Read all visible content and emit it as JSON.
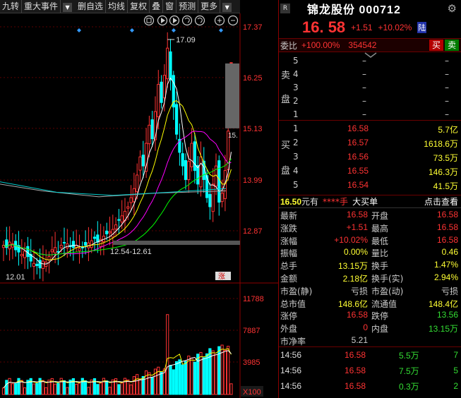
{
  "toolbar": {
    "items": [
      "九转",
      "重大事件",
      "",
      "删自选",
      "均线",
      "复权",
      "叠",
      "窗",
      "预测",
      "更多"
    ],
    "more_arrow": "▼"
  },
  "chart": {
    "price_axis": [
      "17.37",
      "16.25",
      "15.13",
      "13.99",
      "12.87"
    ],
    "vol_axis": [
      "11788",
      "7887",
      "3985"
    ],
    "vol_unit": "X100",
    "high_label": "17.09",
    "low_label": "12.01",
    "range_label": "12.54-12.61",
    "last_label": "15.",
    "tag": "涨",
    "tool_icons": [
      "hand-icon",
      "play-icon",
      "play-icon",
      "undo-icon",
      "redo-icon",
      "zoom-in-icon",
      "zoom-out-icon"
    ],
    "colors": {
      "up": "#ff3333",
      "down": "#00ffff",
      "ma5": "#ffffff",
      "ma10": "#ffff00",
      "ma20": "#ff00ff",
      "ma60": "#00ff00"
    }
  },
  "header": {
    "badge": "R",
    "title": "锦龙股份 000712",
    "price": "16. 58",
    "change": "+1.51",
    "change_pct": "+10.02%",
    "board": "陆"
  },
  "weibi": {
    "label": "委比",
    "pct": "+100.00%",
    "diff": "354542",
    "buy_label": "买",
    "sell_label": "卖"
  },
  "sell_book": {
    "side_label": [
      "卖",
      "盘"
    ],
    "levels": [
      "5",
      "4",
      "3",
      "2",
      "1"
    ],
    "dash": "–"
  },
  "buy_book": {
    "side_label": [
      "买",
      "盘"
    ],
    "rows": [
      {
        "lvl": "1",
        "price": "16.58",
        "vol": "5.7亿"
      },
      {
        "lvl": "2",
        "price": "16.57",
        "vol": "1618.6万"
      },
      {
        "lvl": "3",
        "price": "16.56",
        "vol": "73.5万"
      },
      {
        "lvl": "4",
        "price": "16.55",
        "vol": "146.3万"
      },
      {
        "lvl": "5",
        "price": "16.54",
        "vol": "41.5万"
      }
    ]
  },
  "infoline": {
    "price": "16.50",
    "unit": "元有",
    "hidden": "****手",
    "big": "大买单",
    "link": "点击查看"
  },
  "stats": [
    {
      "l1": "最新",
      "v1": "16.58",
      "c1": "#ff3333",
      "l2": "开盘",
      "v2": "16.58",
      "c2": "#ff3333"
    },
    {
      "l1": "涨跌",
      "v1": "+1.51",
      "c1": "#ff3333",
      "l2": "最高",
      "v2": "16.58",
      "c2": "#ff3333"
    },
    {
      "l1": "涨幅",
      "v1": "+10.02%",
      "c1": "#ff3333",
      "l2": "最低",
      "v2": "16.58",
      "c2": "#ff3333"
    },
    {
      "l1": "振幅",
      "v1": "0.00%",
      "c1": "#ffff33",
      "l2": "量比",
      "v2": "0.46",
      "c2": "#ffff33"
    },
    {
      "l1": "总手",
      "v1": "13.15万",
      "c1": "#ffff33",
      "l2": "换手",
      "v2": "1.47%",
      "c2": "#ffff33"
    },
    {
      "l1": "金额",
      "v1": "2.18亿",
      "c1": "#ffff33",
      "l2": "换手(实)",
      "v2": "2.94%",
      "c2": "#ffff33"
    },
    {
      "l1": "市盈(静)",
      "v1": "亏损",
      "c1": "#cccccc",
      "l2": "市盈(动)",
      "v2": "亏损",
      "c2": "#cccccc"
    },
    {
      "l1": "总市值",
      "v1": "148.6亿",
      "c1": "#ffff33",
      "l2": "流通值",
      "v2": "148.4亿",
      "c2": "#ffff33"
    },
    {
      "l1": "涨停",
      "v1": "16.58",
      "c1": "#ff3333",
      "l2": "跌停",
      "v2": "13.56",
      "c2": "#33dd33"
    },
    {
      "l1": "外盘",
      "v1": "0",
      "c1": "#ff3333",
      "l2": "内盘",
      "v2": "13.15万",
      "c2": "#33dd33"
    },
    {
      "l1": "市净率",
      "v1": "5.21",
      "c1": "#cccccc",
      "l2": "",
      "v2": "",
      "c2": "#cccccc"
    }
  ],
  "trades": [
    {
      "time": "14:56",
      "price": "16.58",
      "vol": "5.5万",
      "n": "7"
    },
    {
      "time": "14:56",
      "price": "16.58",
      "vol": "7.5万",
      "n": "5"
    },
    {
      "time": "14:56",
      "price": "16.58",
      "vol": "0.3万",
      "n": "2"
    }
  ]
}
